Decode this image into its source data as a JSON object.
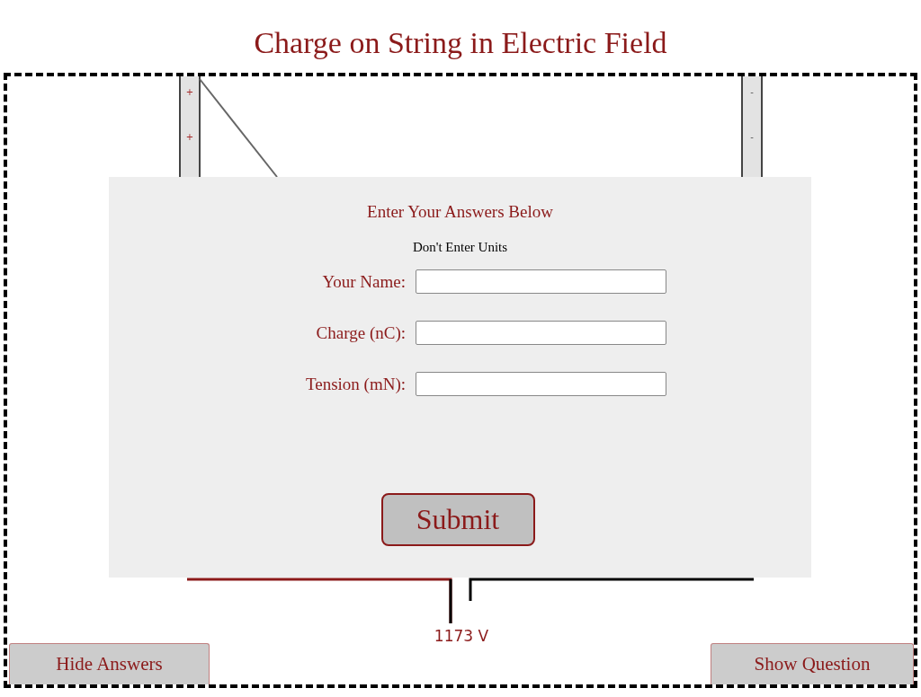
{
  "title": "Charge on String in Electric Field",
  "plates": [
    {
      "kind": "positive",
      "signs": [
        "+",
        "+"
      ]
    },
    {
      "kind": "negative",
      "signs": [
        "-",
        "-"
      ]
    }
  ],
  "form": {
    "heading": "Enter Your Answers Below",
    "note": "Don't Enter Units",
    "fields": [
      {
        "label": "Your Name:"
      },
      {
        "label": "Charge (nC):"
      },
      {
        "label": "Tension (mN):"
      }
    ],
    "submit": "Submit"
  },
  "voltage": "1173 V",
  "buttons": [
    {
      "label": "Hide Answers"
    },
    {
      "label": "Show Question"
    }
  ]
}
